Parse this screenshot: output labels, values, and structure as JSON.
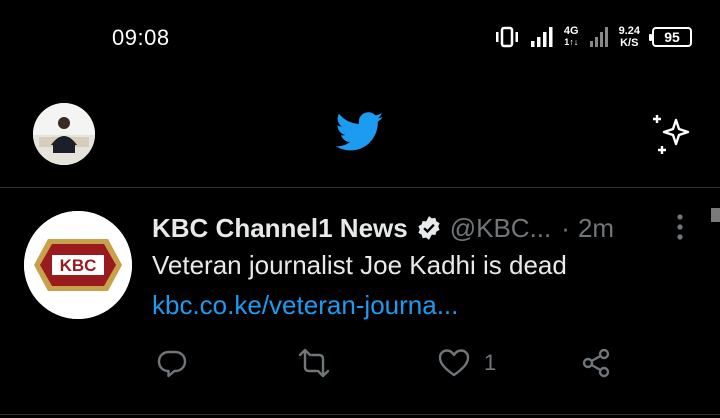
{
  "status_bar": {
    "time": "09:08",
    "network_type_top": "4G",
    "network_type_bottom": "1↑↓",
    "net_speed_value": "9.24",
    "net_speed_unit": "K/S",
    "battery": "95"
  },
  "header": {
    "profile_avatar_icon": "profile-avatar",
    "logo_icon": "twitter-bird",
    "sparkle_icon": "sparkle",
    "accent_color": "#1d9bf0"
  },
  "tweet": {
    "avatar_logo_text": "KBC",
    "author_name": "KBC Channel1 News",
    "handle": "@KBC...",
    "separator": "·",
    "time_ago": "2m",
    "text": "Veteran journalist Joe Kadhi is dead",
    "link": "kbc.co.ke/veteran-journa...",
    "like_count": "1",
    "link_color": "#1d9bf0"
  }
}
